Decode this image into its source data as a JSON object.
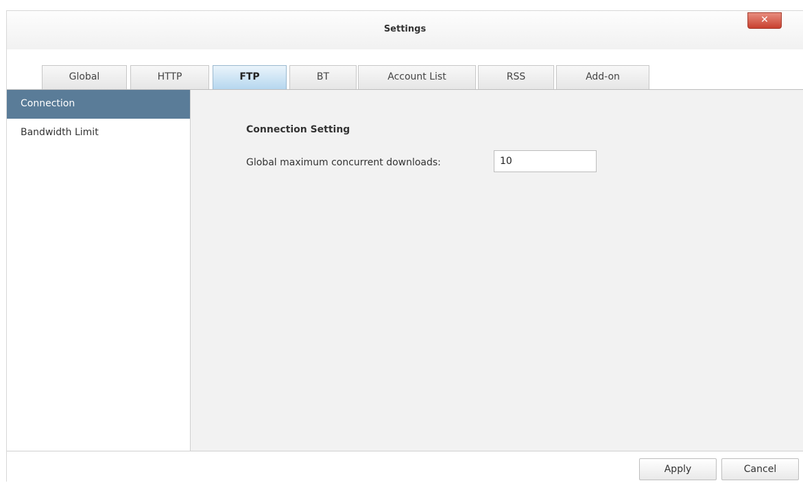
{
  "window": {
    "title": "Settings"
  },
  "tabs": [
    {
      "label": "Global"
    },
    {
      "label": "HTTP"
    },
    {
      "label": "FTP"
    },
    {
      "label": "BT"
    },
    {
      "label": "Account List"
    },
    {
      "label": "RSS"
    },
    {
      "label": "Add-on"
    }
  ],
  "active_tab": "FTP",
  "sidebar": {
    "items": [
      {
        "label": "Connection"
      },
      {
        "label": "Bandwidth Limit"
      }
    ],
    "active_item": "Connection"
  },
  "main": {
    "section_title": "Connection Setting",
    "max_downloads_label": "Global maximum concurrent downloads:",
    "max_downloads_value": "10"
  },
  "footer": {
    "apply_label": "Apply",
    "cancel_label": "Cancel"
  },
  "colors": {
    "active_tab": "#b6d7ef",
    "sidebar_active": "#5a7c98",
    "close_button": "#c8402f",
    "content_bg": "#f2f2f2"
  },
  "icons": {
    "close": "close-icon"
  }
}
